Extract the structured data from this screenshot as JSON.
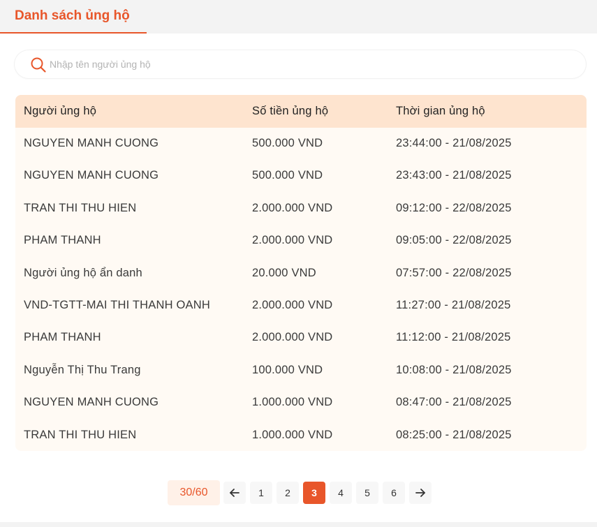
{
  "tabs": {
    "active_label": "Danh sách ủng hộ"
  },
  "search": {
    "placeholder": "Nhập tên người ủng hộ",
    "value": "",
    "icon": "search-icon"
  },
  "colors": {
    "accent": "#e8562a",
    "header_bg": "#fee4cf",
    "table_bg": "#fffaf4"
  },
  "table": {
    "headers": [
      "Người ủng hộ",
      "Số tiền ủng hộ",
      "Thời gian ủng hộ"
    ],
    "rows": [
      {
        "name": "NGUYEN MANH CUONG",
        "amount": "500.000 VND",
        "time": "23:44:00 - 21/08/2025"
      },
      {
        "name": "NGUYEN MANH CUONG",
        "amount": "500.000 VND",
        "time": "23:43:00 - 21/08/2025"
      },
      {
        "name": "TRAN THI THU HIEN",
        "amount": "2.000.000 VND",
        "time": "09:12:00 - 22/08/2025"
      },
      {
        "name": "PHAM THANH",
        "amount": "2.000.000 VND",
        "time": "09:05:00 - 22/08/2025"
      },
      {
        "name": "Người ủng hộ ẩn danh",
        "amount": "20.000 VND",
        "time": "07:57:00 - 22/08/2025"
      },
      {
        "name": "VND-TGTT-MAI THI THANH OANH",
        "amount": "2.000.000 VND",
        "time": "11:27:00 - 21/08/2025"
      },
      {
        "name": "PHAM THANH",
        "amount": "2.000.000 VND",
        "time": "11:12:00 - 21/08/2025"
      },
      {
        "name": "Nguyễn Thị Thu Trang",
        "amount": "100.000 VND",
        "time": "10:08:00 - 21/08/2025"
      },
      {
        "name": "NGUYEN MANH CUONG",
        "amount": "1.000.000 VND",
        "time": "08:47:00 - 21/08/2025"
      },
      {
        "name": "TRAN THI THU HIEN",
        "amount": "1.000.000 VND",
        "time": "08:25:00 - 21/08/2025"
      }
    ]
  },
  "pagination": {
    "count": "30/60",
    "prev_icon": "arrow-left-icon",
    "next_icon": "arrow-right-icon",
    "pages": [
      "1",
      "2",
      "3",
      "4",
      "5",
      "6"
    ],
    "current_page": "3"
  }
}
